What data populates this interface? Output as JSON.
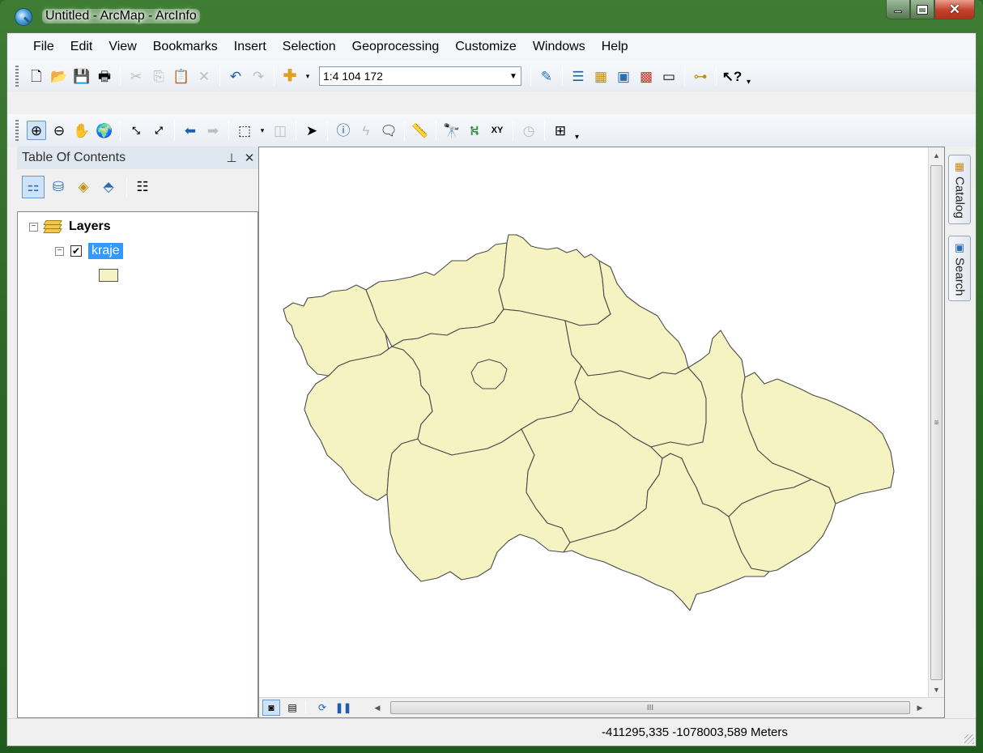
{
  "window": {
    "title": "Untitled - ArcMap - ArcInfo",
    "app_icon": "arcmap-globe-icon"
  },
  "menubar": {
    "items": [
      "File",
      "Edit",
      "View",
      "Bookmarks",
      "Insert",
      "Selection",
      "Geoprocessing",
      "Customize",
      "Windows",
      "Help"
    ]
  },
  "standard_toolbar": {
    "scale": "1:4 104 172",
    "icons": [
      "new-document-icon",
      "open-icon",
      "save-icon",
      "print-icon",
      "cut-icon",
      "copy-icon",
      "paste-icon",
      "delete-icon",
      "undo-icon",
      "redo-icon",
      "add-data-icon",
      "editor-toolbar-icon",
      "table-of-contents-icon",
      "catalog-window-icon",
      "search-window-icon",
      "arctoolbox-icon",
      "python-window-icon",
      "modelbuilder-icon",
      "whats-this-icon"
    ]
  },
  "tools_toolbar": {
    "icons": [
      "zoom-in-icon",
      "zoom-out-icon",
      "pan-icon",
      "full-extent-icon",
      "fixed-zoom-in-icon",
      "fixed-zoom-out-icon",
      "back-extent-icon",
      "forward-extent-icon",
      "select-features-icon",
      "clear-selection-icon",
      "select-elements-icon",
      "identify-icon",
      "hyperlink-icon",
      "html-popup-icon",
      "measure-icon",
      "find-icon",
      "find-route-icon",
      "go-to-xy-icon",
      "time-slider-icon",
      "magnifier-icon"
    ]
  },
  "toc": {
    "title": "Table Of Contents",
    "root": {
      "label": "Layers",
      "layer": {
        "name": "kraje",
        "checked": true,
        "symbol_color": "#f5f3c1"
      }
    }
  },
  "map": {
    "fill_color": "#f5f3c1",
    "outline_color": "#4a4a4a",
    "scrollbar_grip": "III",
    "vscroll_grip": "≡"
  },
  "dock": {
    "catalog_label": "Catalog",
    "search_label": "Search"
  },
  "status": {
    "coordinates": "-411295,335  -1078003,589 Meters"
  }
}
